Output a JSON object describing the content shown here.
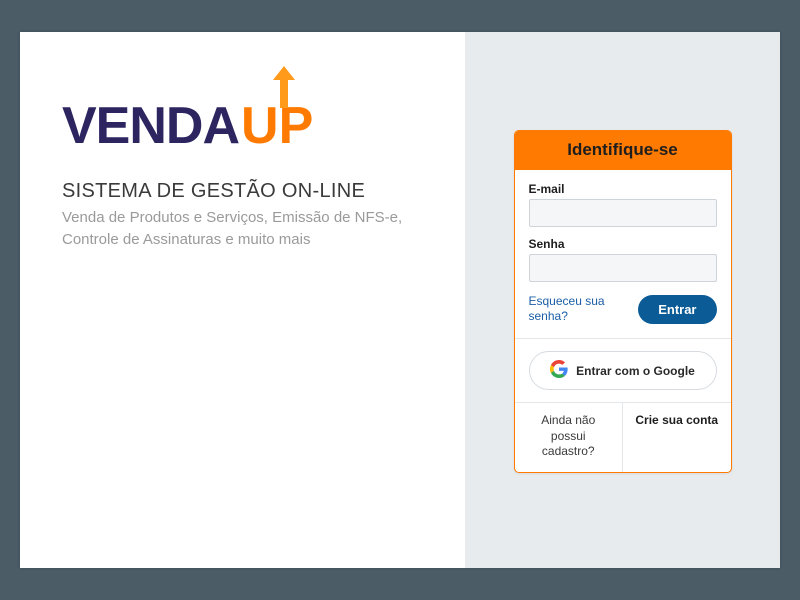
{
  "brand": {
    "part1": "VENDA",
    "part2": "UP",
    "tagline_title": "SISTEMA DE GESTÃO ON-LINE",
    "tagline_sub": "Venda de Produtos e Serviços, Emissão de NFS-e, Controle de Assinaturas e muito mais"
  },
  "login": {
    "header": "Identifique-se",
    "email_label": "E-mail",
    "email_value": "",
    "password_label": "Senha",
    "password_value": "",
    "forgot": "Esqueceu sua senha?",
    "submit": "Entrar",
    "google": "Entrar com o Google",
    "no_account": "Ainda não possui cadastro?",
    "create_account": "Crie sua conta"
  },
  "colors": {
    "brand_orange": "#ff7a00",
    "brand_navy": "#2c2560",
    "button_blue": "#0a5b96",
    "link_blue": "#1b5ea6"
  }
}
